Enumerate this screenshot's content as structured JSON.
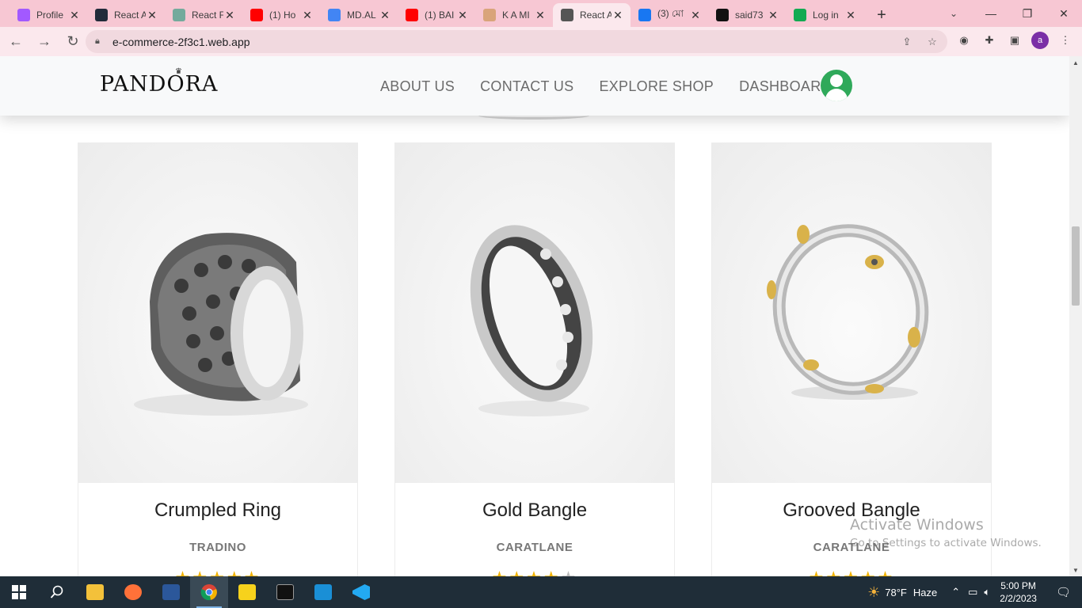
{
  "browser": {
    "tabs": [
      {
        "title": "Profile",
        "icon": "profile-favicon",
        "color": "#a259ff"
      },
      {
        "title": "React A",
        "icon": "react-favicon",
        "color": "#222b3a"
      },
      {
        "title": "React F",
        "icon": "chatgpt-favicon",
        "color": "#74aa9c"
      },
      {
        "title": "(1) Ho",
        "icon": "youtube-favicon",
        "color": "#ff0000"
      },
      {
        "title": "MD.AL",
        "icon": "docs-favicon",
        "color": "#4285f4"
      },
      {
        "title": "(1) BAI",
        "icon": "youtube-favicon",
        "color": "#ff0000"
      },
      {
        "title": "K A MI",
        "icon": "avatar-favicon",
        "color": "#d9a47a"
      },
      {
        "title": "React A",
        "icon": "rings-favicon",
        "color": "#555555",
        "active": true
      },
      {
        "title": "(3) মো",
        "icon": "facebook-favicon",
        "color": "#1877f2"
      },
      {
        "title": "said73",
        "icon": "github-favicon",
        "color": "#111111"
      },
      {
        "title": "Log in",
        "icon": "mongodb-favicon",
        "color": "#13aa52"
      }
    ],
    "url": "e-commerce-2f3c1.web.app",
    "profile_initial": "a"
  },
  "site": {
    "logo": "PANDORA",
    "nav": [
      "ABOUT US",
      "CONTACT US",
      "EXPLORE SHOP",
      "DASHBOARD"
    ]
  },
  "products": [
    {
      "name": "Crumpled Ring",
      "brand": "TRADINO",
      "rating": 5
    },
    {
      "name": "Gold Bangle",
      "brand": "CARATLANE",
      "rating": 4
    },
    {
      "name": "Grooved Bangle",
      "brand": "CARATLANE",
      "rating": 5
    }
  ],
  "watermark": {
    "line1": "Activate Windows",
    "line2": "Go to Settings to activate Windows."
  },
  "taskbar": {
    "weather_temp": "78°F",
    "weather_text": "Haze",
    "time": "5:00 PM",
    "date": "2/2/2023"
  }
}
